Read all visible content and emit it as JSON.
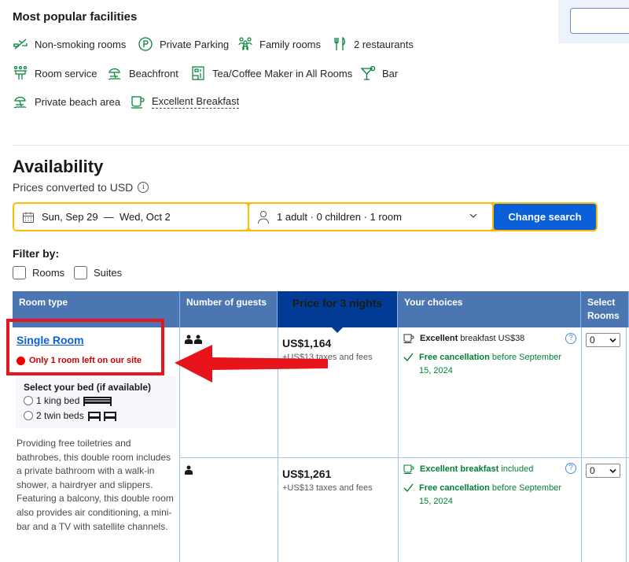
{
  "facilities": {
    "title": "Most popular facilities",
    "items": [
      {
        "label": "Non-smoking rooms",
        "icon": "no-smoking-icon"
      },
      {
        "label": "Private Parking",
        "icon": "parking-icon"
      },
      {
        "label": "Family rooms",
        "icon": "family-icon"
      },
      {
        "label": "2 restaurants",
        "icon": "restaurant-icon"
      },
      {
        "label": "Room service",
        "icon": "room-service-icon"
      },
      {
        "label": "Beachfront",
        "icon": "beach-icon"
      },
      {
        "label": "Tea/Coffee Maker in All Rooms",
        "icon": "coffee-maker-icon"
      },
      {
        "label": "Bar",
        "icon": "cocktail-icon"
      },
      {
        "label": "Private beach area",
        "icon": "beach-icon"
      },
      {
        "label": "Excellent Breakfast",
        "icon": "cup-icon"
      }
    ]
  },
  "availability": {
    "title": "Availability",
    "subtitle": "Prices converted to USD",
    "info_icon": "i"
  },
  "search": {
    "dates": "Sun, Sep 29  —  Wed, Oct 2",
    "guests": "1 adult · 0 children · 1 room",
    "button": "Change search"
  },
  "filter": {
    "label": "Filter by:",
    "options": [
      "Rooms",
      "Suites"
    ]
  },
  "table": {
    "headers": [
      "Room type",
      "Number of guests",
      "Price for 3 nights",
      "Your choices",
      "Select Rooms"
    ],
    "room": {
      "name": "Single Room",
      "scarcity": "Only 1 room left on our site",
      "bed_title": "Select your bed (if available)",
      "bed_options": [
        "1 king bed",
        "2 twin beds"
      ],
      "description": "Providing free toiletries and bathrobes, this double room includes a private bathroom with a walk-in shower, a hairdryer and slippers. Featuring a balcony, this double room also provides air conditioning, a mini-bar and a TV with satellite channels."
    },
    "rows": [
      {
        "guests": 2,
        "price": "US$1,164",
        "taxes": "+US$13 taxes and fees",
        "breakfast_bold": "Excellent",
        "breakfast_rest": " breakfast US$38",
        "cancellation_bold": "Free cancellation",
        "cancellation_rest": " before September 15, 2024",
        "select_value": "0"
      },
      {
        "guests": 1,
        "price": "US$1,261",
        "taxes": "+US$13 taxes and fees",
        "breakfast_bold": "Excellent breakfast",
        "breakfast_rest": " included",
        "cancellation_bold": "Free cancellation",
        "cancellation_rest": " before September 15, 2024",
        "select_value": "0"
      }
    ],
    "help_icon": "?"
  },
  "colors": {
    "facility_green": "#008234",
    "brand_blue": "#0b5fd8",
    "header_blue": "#4c76b2",
    "price_header": "#003b95",
    "search_yellow": "#febb02",
    "annotation_red": "#e8141b"
  }
}
